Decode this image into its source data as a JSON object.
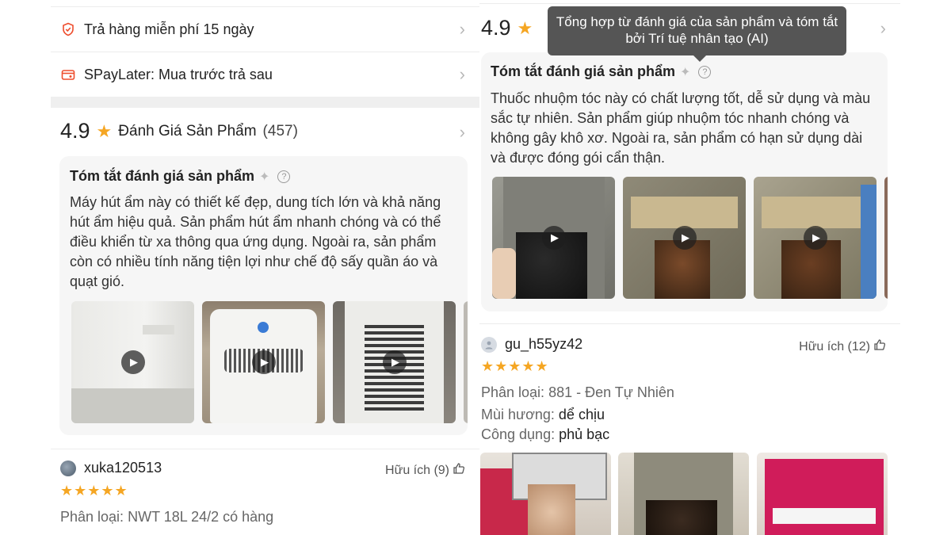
{
  "left": {
    "rows": [
      {
        "icon": "shield-return-icon",
        "label": "Trả hàng miễn phí 15 ngày"
      },
      {
        "icon": "spaylater-icon",
        "label": "SPayLater: Mua trước trả sau"
      }
    ],
    "rating": {
      "score": "4.9",
      "title": "Đánh Giá Sản Phẩm",
      "count": "(457)"
    },
    "summary": {
      "title": "Tóm tắt đánh giá sản phẩm",
      "lines": [
        "Máy hút ẩm này có thiết kế đẹp, dung tích lớn và khả năng",
        "hút ẩm hiệu quả. Sản phẩm hút ẩm nhanh chóng và có thể",
        "điều khiển từ xa thông qua ứng dụng. Ngoài ra, sản phẩm",
        "còn có nhiều tính năng tiện lợi như chế độ sấy quần áo và",
        "quạt gió."
      ]
    },
    "review": {
      "username": "xuka120513",
      "helpful": "Hữu ích (9)",
      "stars": "★★★★★",
      "variant_label": "Phân loại:",
      "variant_value": "NWT 18L 24/2 có hàng"
    }
  },
  "right": {
    "rating": {
      "score": "4.9"
    },
    "tooltip": "Tổng hợp từ đánh giá của sản phẩm và tóm tắt bởi Trí tuệ nhân tạo (AI)",
    "summary": {
      "title": "Tóm tắt đánh giá sản phẩm",
      "lines": [
        "Thuốc nhuộm tóc này có chất lượng tốt, dễ sử dụng và màu",
        "sắc tự nhiên. Sản phẩm giúp nhuộm tóc nhanh chóng và",
        "không gây khô xơ. Ngoài ra, sản phẩm có hạn sử dụng dài",
        "và được đóng gói cẩn thận."
      ]
    },
    "review": {
      "username": "gu_h55yz42",
      "helpful": "Hữu ích (12)",
      "stars": "★★★★★",
      "variant_label": "Phân loại:",
      "variant_value": "881 - Đen Tự Nhiên",
      "scent_label": "Mùi hương:",
      "scent_value": "dể chịu",
      "use_label": "Công dụng:",
      "use_value": "phủ bạc"
    }
  },
  "colors": {
    "star": "#f5a623",
    "accent": "#ee4d2d",
    "tooltip_bg": "#555555"
  }
}
